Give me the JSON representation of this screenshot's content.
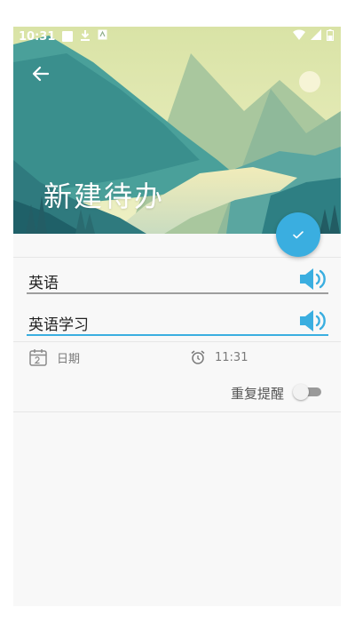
{
  "status_bar": {
    "time": "10:31"
  },
  "header": {
    "title": "新建待办",
    "back_icon": "arrow-left-icon",
    "confirm_icon": "check-icon",
    "accent_color": "#3aaee0"
  },
  "form": {
    "title_value": "英语",
    "content_value": "英语学习",
    "date_label": "日期",
    "time_label": "11:31",
    "repeat_label": "重复提醒",
    "repeat_enabled": false
  }
}
